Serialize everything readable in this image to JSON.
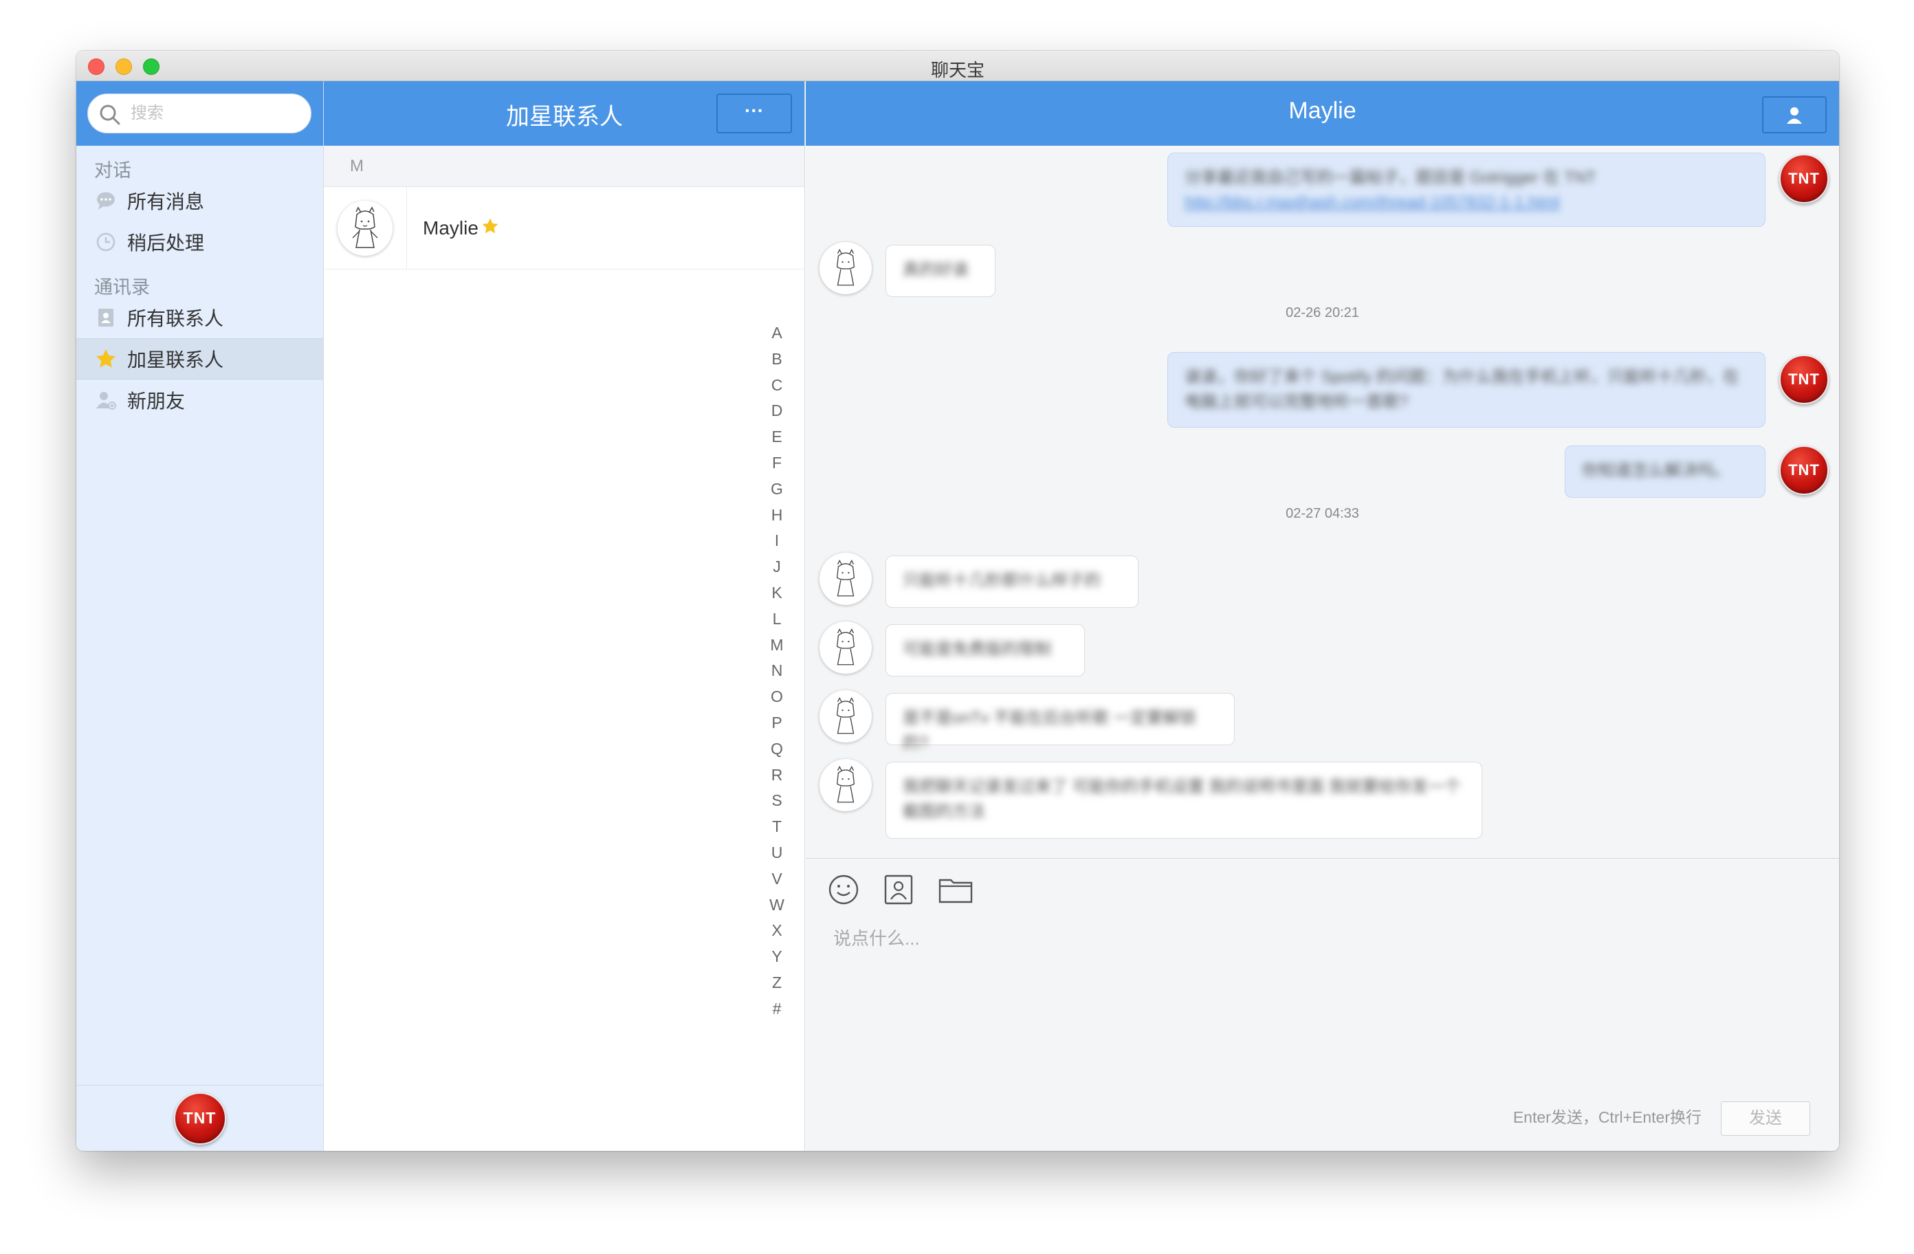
{
  "window": {
    "title": "聊天宝"
  },
  "sidebar": {
    "search": {
      "placeholder": "搜索"
    },
    "sections": [
      {
        "label": "对话",
        "items": [
          {
            "label": "所有消息",
            "icon": "chat-bubble-icon"
          },
          {
            "label": "稍后处理",
            "icon": "clock-icon"
          }
        ]
      },
      {
        "label": "通讯录",
        "items": [
          {
            "label": "所有联系人",
            "icon": "address-book-icon"
          },
          {
            "label": "加星联系人",
            "icon": "star-icon",
            "active": true
          },
          {
            "label": "新朋友",
            "icon": "add-friend-icon"
          }
        ]
      }
    ],
    "self_avatar": "TNT"
  },
  "contacts": {
    "title": "加星联系人",
    "more_label": "···",
    "group_letter": "M",
    "items": [
      {
        "name": "Maylie",
        "starred": true
      }
    ],
    "index": [
      "A",
      "B",
      "C",
      "D",
      "E",
      "F",
      "G",
      "H",
      "I",
      "J",
      "K",
      "L",
      "M",
      "N",
      "O",
      "P",
      "Q",
      "R",
      "S",
      "T",
      "U",
      "V",
      "W",
      "X",
      "Y",
      "Z",
      "#"
    ]
  },
  "chat": {
    "title": "Maylie",
    "messages": [
      {
        "dir": "out",
        "avatar": "TNT",
        "text": "分享最近我自己写的一篇帖子，题目是 Gotrigger 在 TNT",
        "link": "http://bbs.r.maxthash.com/thread-1057832-1-1.html"
      },
      {
        "dir": "in",
        "text": "真的好诶"
      },
      {
        "timestamp": "02-26 20:21"
      },
      {
        "dir": "out",
        "avatar": "TNT",
        "text": "诶诶，你好了来个 Spotify 的问题：为什么我在手机上听，只能听十几秒，在电脑上就可以完整地听一首歌?"
      },
      {
        "dir": "out",
        "avatar": "TNT",
        "text": "你知道怎么解决吗。"
      },
      {
        "timestamp": "02-27 04:33"
      },
      {
        "dir": "in",
        "text": "只能听十几秒那什么样子的"
      },
      {
        "dir": "in",
        "text": "可能是免费版的限制"
      },
      {
        "dir": "in",
        "text": "是不是onTv 不能在后台听歌 一定要解锁的?"
      },
      {
        "dir": "in",
        "text": "我把聊天记录发过来了 可能你的手机设置 我的说明书里面 我就要给你发一个截图的方法"
      }
    ],
    "composer": {
      "placeholder": "说点什么...",
      "hint": "Enter发送，Ctrl+Enter换行",
      "send_label": "发送",
      "tools": [
        "emoji-icon",
        "contact-card-icon",
        "folder-icon"
      ]
    }
  }
}
